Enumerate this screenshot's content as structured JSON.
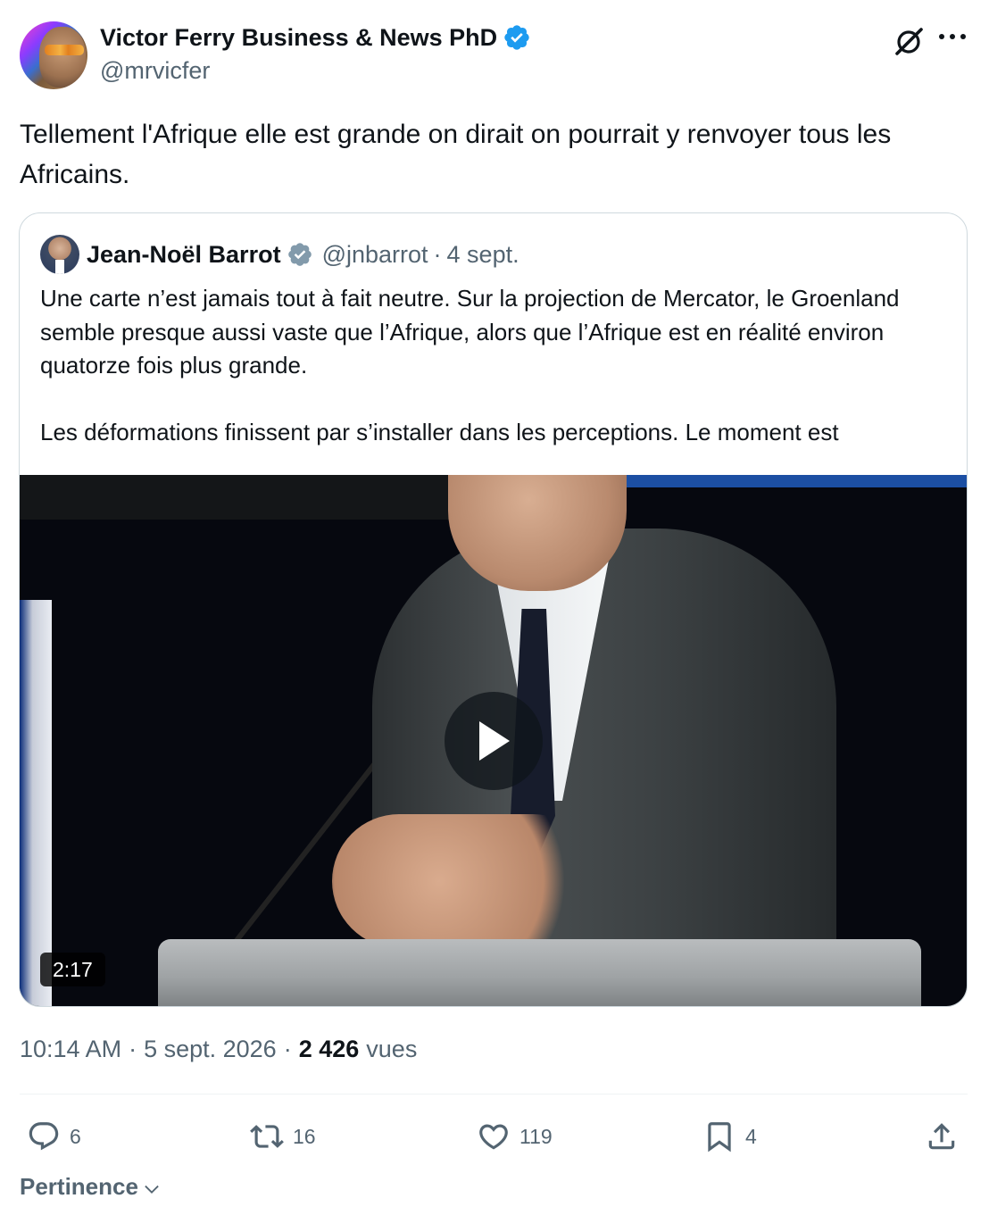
{
  "author": {
    "display_name": "Victor Ferry Business & News PhD",
    "handle": "@mrvicfer",
    "verified": true
  },
  "tweet": {
    "text": "Tellement l'Afrique elle est grande on dirait on pourrait y renvoyer tous les Africains."
  },
  "quoted_tweet": {
    "display_name": "Jean-Noël Barrot",
    "handle": "@jnbarrot",
    "separator": "·",
    "date": "4 sept.",
    "verified": true,
    "paragraph_1": "Une carte n’est jamais tout à fait neutre. Sur la projection de Mercator, le Groenland semble presque aussi vaste que l’Afrique, alors que l’Afrique est en réalité environ quatorze fois plus grande.",
    "paragraph_2": "Les déformations finissent par s’installer dans les perceptions. Le moment est",
    "video": {
      "duration": "2:17"
    }
  },
  "meta": {
    "time": "10:14 AM",
    "separator_1": "·",
    "date": "5 sept. 2026",
    "separator_2": "·",
    "views_count": "2 426",
    "views_label": "vues"
  },
  "actions": {
    "replies": "6",
    "retweets": "16",
    "likes": "119",
    "bookmarks": "4"
  },
  "sort": {
    "label": "Pertinence"
  },
  "colors": {
    "verified_blue": "#1d9bf0",
    "verified_gray": "#829aab",
    "secondary_text": "#536471",
    "primary_text": "#0f1419",
    "border": "#cfd9de"
  },
  "icons": {
    "verified": "verified-badge-icon",
    "grok": "grok-icon",
    "more": "more-options-icon",
    "play": "play-icon",
    "reply": "reply-icon",
    "retweet": "retweet-icon",
    "like": "heart-icon",
    "bookmark": "bookmark-icon",
    "share": "share-icon",
    "chevron": "chevron-down-icon"
  }
}
